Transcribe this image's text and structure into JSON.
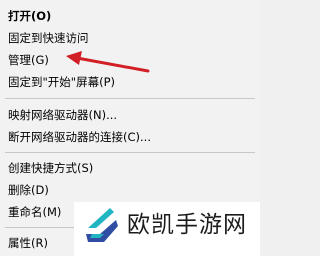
{
  "menu": {
    "items": [
      {
        "label": "打开(O)"
      },
      {
        "label": "固定到快速访问"
      },
      {
        "label": "管理(G)"
      },
      {
        "label": "固定到\"开始\"屏幕(P)"
      },
      {
        "label": "映射网络驱动器(N)..."
      },
      {
        "label": "断开网络驱动器的连接(C)..."
      },
      {
        "label": "创建快捷方式(S)"
      },
      {
        "label": "删除(D)"
      },
      {
        "label": "重命名(M)"
      },
      {
        "label": "属性(R)"
      }
    ]
  },
  "annotation": {
    "color": "#d21f26"
  },
  "watermark": {
    "text": "欧凯手游网",
    "logo": "ok-swoosh-logo",
    "logo_colors": [
      "#21b5c4",
      "#2f4ea3"
    ]
  }
}
